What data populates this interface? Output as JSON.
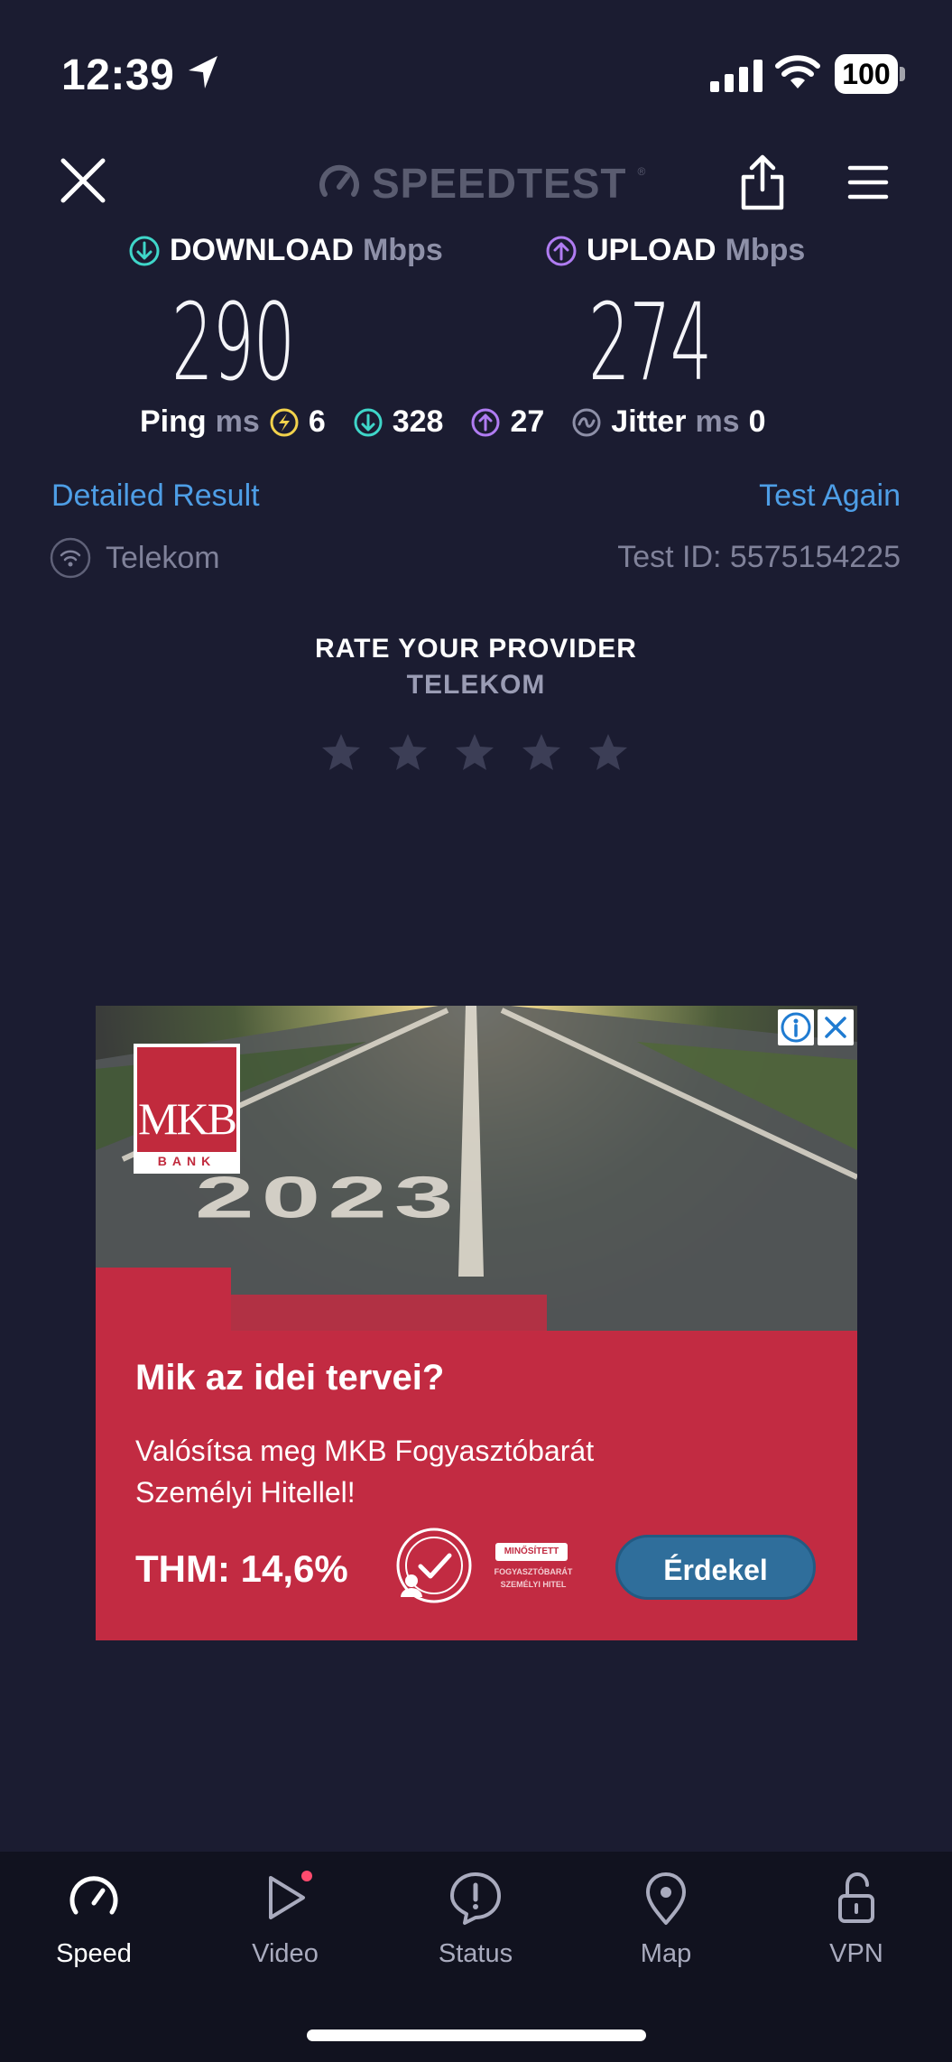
{
  "status_bar": {
    "time": "12:39",
    "battery": "100"
  },
  "header": {
    "brand": "SPEEDTEST",
    "brand_tm": "®"
  },
  "download": {
    "label": "DOWNLOAD",
    "unit": "Mbps",
    "value": "290"
  },
  "upload": {
    "label": "UPLOAD",
    "unit": "Mbps",
    "value": "274"
  },
  "ping": {
    "label": "Ping",
    "unit": "ms",
    "idle": "6",
    "download": "328",
    "upload": "27"
  },
  "jitter": {
    "label": "Jitter",
    "unit": "ms",
    "value": "0"
  },
  "links": {
    "detailed": "Detailed Result",
    "again": "Test Again"
  },
  "provider": {
    "name": "Telekom",
    "test_id": "Test ID: 5575154225"
  },
  "rating": {
    "title": "RATE YOUR PROVIDER",
    "subtitle": "TELEKOM",
    "stars": 5
  },
  "ad": {
    "logo": "MKB",
    "logo_sub": "BANK",
    "year": "2023",
    "headline": "Mik az idei tervei?",
    "body": "Valósítsa meg MKB Fogyasztóbarát Személyi Hitellel!",
    "thm": "THM: 14,6%",
    "badge_label": "MINŐSÍTETT",
    "badge_small": "FOGYASZTÓBARÁT SZEMÉLYI HITEL",
    "cta": "Érdekel"
  },
  "nav": {
    "items": [
      {
        "label": "Speed",
        "icon": "speedometer-icon",
        "active": true
      },
      {
        "label": "Video",
        "icon": "play-icon",
        "active": false
      },
      {
        "label": "Status",
        "icon": "alert-icon",
        "active": false
      },
      {
        "label": "Map",
        "icon": "map-pin-icon",
        "active": false
      },
      {
        "label": "VPN",
        "icon": "unlock-icon",
        "active": false
      }
    ]
  },
  "colors": {
    "background": "#1b1c31",
    "download": "#3fd6c9",
    "upload": "#b07cf2",
    "ping": "#f2d24c",
    "link": "#4e9ee6",
    "ad_red": "#c22b42",
    "video_dot": "#ff4b6e"
  }
}
